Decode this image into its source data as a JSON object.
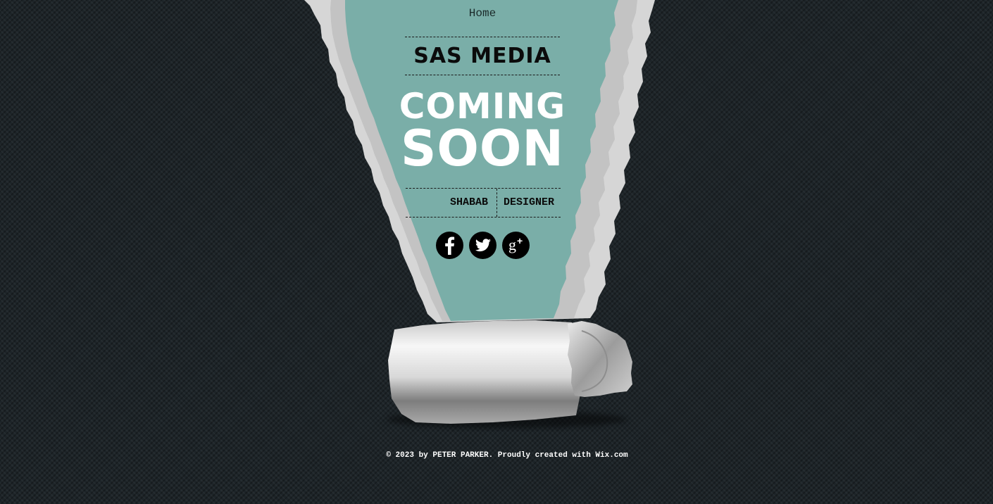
{
  "nav": {
    "home_label": "Home"
  },
  "brand": {
    "title": "SAS MEDIA"
  },
  "headline": {
    "line1": "COMING",
    "line2": "SOON"
  },
  "credits": {
    "name": "SHABAB",
    "role": "DESIGNER"
  },
  "social": {
    "items": [
      {
        "icon": "facebook-icon"
      },
      {
        "icon": "twitter-icon"
      },
      {
        "icon": "google-plus-icon"
      }
    ]
  },
  "footer": {
    "copyright": "© 2023 by PETER PARKER. Proudly created with ",
    "link_text": "Wix.com"
  },
  "colors": {
    "background": "#1d2428",
    "teal": "#7aaea8",
    "paper": "#e2e2e2",
    "text_dark": "#0b0b0b",
    "text_light": "#ffffff"
  }
}
